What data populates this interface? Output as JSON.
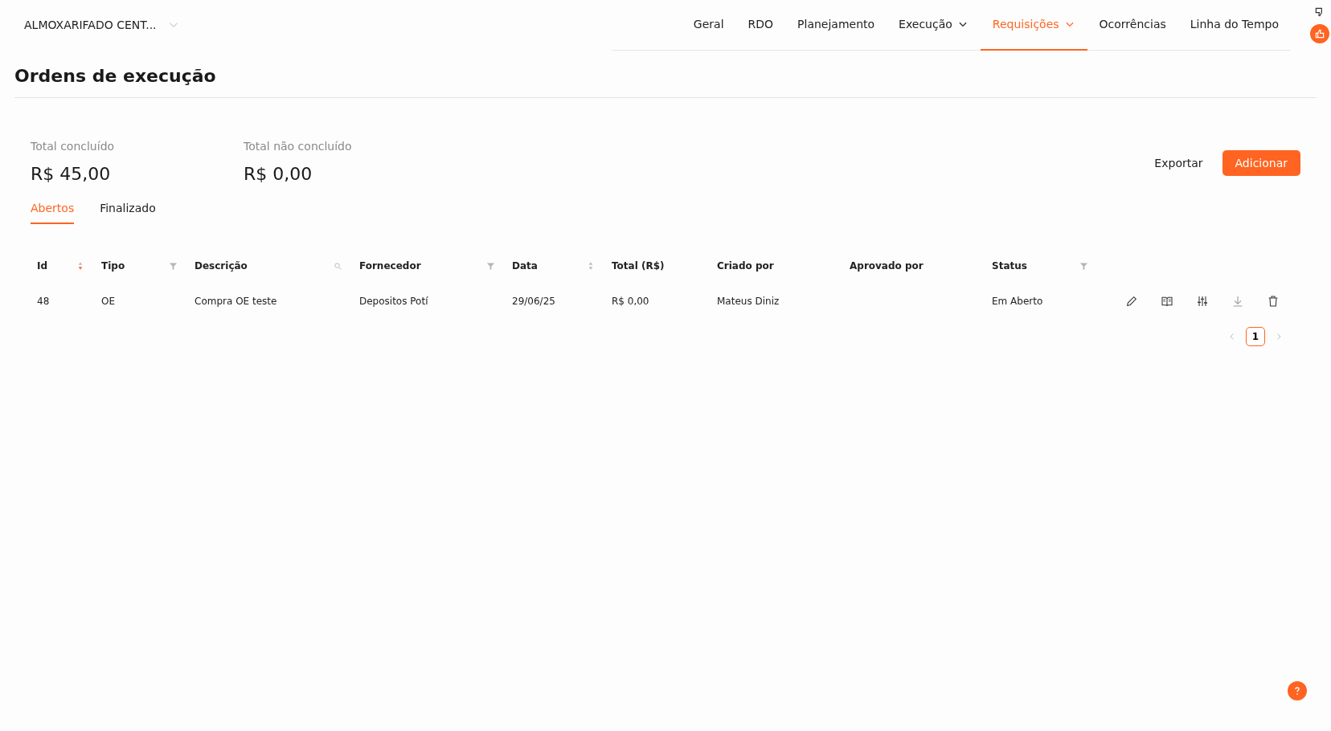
{
  "project_selector": {
    "value": "ALMOXARIFADO CENT..."
  },
  "nav": [
    {
      "label": "Geral",
      "selected": false,
      "dropdown": false
    },
    {
      "label": "RDO",
      "selected": false,
      "dropdown": false
    },
    {
      "label": "Planejamento",
      "selected": false,
      "dropdown": false
    },
    {
      "label": "Execução",
      "selected": false,
      "dropdown": true
    },
    {
      "label": "Requisições",
      "selected": true,
      "dropdown": true
    },
    {
      "label": "Ocorrências",
      "selected": false,
      "dropdown": false
    },
    {
      "label": "Linha do Tempo",
      "selected": false,
      "dropdown": false
    }
  ],
  "page_title": "Ordens de execução",
  "totals": [
    {
      "label": "Total concluído",
      "value": "R$ 45,00"
    },
    {
      "label": "Total não concluído",
      "value": "R$ 0,00"
    }
  ],
  "actions": {
    "export": "Exportar",
    "add": "Adicionar"
  },
  "tabs": [
    {
      "label": "Abertos",
      "selected": true
    },
    {
      "label": "Finalizado",
      "selected": false
    }
  ],
  "table": {
    "columns": [
      {
        "label": "Id",
        "kind": "sort",
        "sort_descending": true
      },
      {
        "label": "Tipo",
        "kind": "filter"
      },
      {
        "label": "Descrição",
        "kind": "search"
      },
      {
        "label": "Fornecedor",
        "kind": "filter"
      },
      {
        "label": "Data",
        "kind": "sort",
        "sort_descending": false
      },
      {
        "label": "Total (R$)",
        "kind": "plain"
      },
      {
        "label": "Criado por",
        "kind": "plain"
      },
      {
        "label": "Aprovado por",
        "kind": "plain"
      },
      {
        "label": "Status",
        "kind": "filter"
      }
    ],
    "rows": [
      {
        "cells": [
          "48",
          "OE",
          "Compra OE teste",
          "Depositos Potí",
          "29/06/25",
          "R$ 0,00",
          "Mateus Diniz",
          "",
          "Em Aberto"
        ]
      }
    ]
  },
  "pagination": {
    "pages": [
      {
        "label": "1",
        "selected": true
      }
    ]
  }
}
